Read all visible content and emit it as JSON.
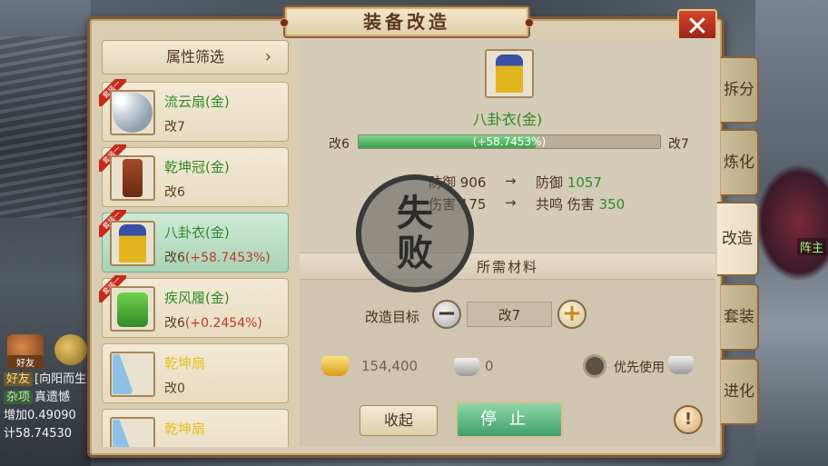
{
  "window": {
    "title": "装备改造",
    "close_symbol": "✕"
  },
  "left_list": {
    "filter_label": "属性筛选",
    "filter_chevron": "›",
    "items": [
      {
        "name": "流云扇(金)",
        "level": "改7",
        "pct": "",
        "ribbon": "套装一",
        "name_color": "green",
        "icon": "white-fan-icon"
      },
      {
        "name": "乾坤冠(金)",
        "level": "改6",
        "pct": "",
        "ribbon": "套装一",
        "name_color": "green",
        "icon": "crown-icon"
      },
      {
        "name": "八卦衣(金)",
        "level": "改6",
        "pct": "(+58.7453%)",
        "ribbon": "套装一",
        "name_color": "green",
        "icon": "robe-icon",
        "selected": true
      },
      {
        "name": "疾风履(金)",
        "level": "改6",
        "pct": "(+0.2454%)",
        "ribbon": "套装一",
        "name_color": "green",
        "icon": "boots-icon"
      },
      {
        "name": "乾坤扇",
        "level": "改0",
        "pct": "",
        "ribbon": "",
        "name_color": "yellow",
        "icon": "blue-fan-icon"
      },
      {
        "name": "乾坤扇",
        "level": "",
        "pct": "",
        "ribbon": "",
        "name_color": "yellow",
        "icon": "blue-fan-icon"
      }
    ]
  },
  "detail": {
    "equip_name": "八卦衣(金)",
    "progress": {
      "from": "改6",
      "to": "改7",
      "text": "(+58.7453%)",
      "fraction": 0.587453
    },
    "stats": {
      "defense_label": "防御",
      "defense_from": "906",
      "arrow": "→",
      "defense_to_label": "防御",
      "defense_to": "1057",
      "resonance_label": "伤害",
      "resonance_from": "175",
      "resonance_to_label": "共鸣 伤害",
      "resonance_to": "350"
    },
    "stamp": {
      "line1": "失",
      "line2": "败"
    },
    "materials_title": "所需材料",
    "target_label": "改造目标",
    "target_value": "改7",
    "minus": "−",
    "plus": "+",
    "gold_amount": "154,400",
    "silver_amount": "0",
    "prefer_label": "优先使用",
    "collapse_label": "收起",
    "stop_label": "停止",
    "info_symbol": "!"
  },
  "vertical_tabs": [
    {
      "label": "拆分",
      "active": false
    },
    {
      "label": "炼化",
      "active": false
    },
    {
      "label": "改造",
      "active": true
    },
    {
      "label": "套装",
      "active": false
    },
    {
      "label": "进化",
      "active": false
    }
  ],
  "background": {
    "friend_label": "好友",
    "npc_label": "阵主",
    "chat_lines": [
      {
        "tag": "好友",
        "text": "[向阳而生"
      },
      {
        "tag": "杂项",
        "text": "真遗憾"
      },
      {
        "tag": "",
        "text": "增加0.49090"
      },
      {
        "tag": "",
        "text": "计58.74530"
      }
    ]
  }
}
